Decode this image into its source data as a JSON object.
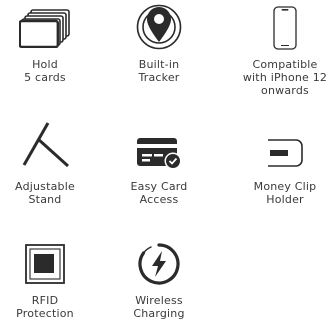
{
  "features": [
    {
      "id": "hold-cards",
      "label_line1": "Hold",
      "label_line2": "5 cards",
      "label_line3": "",
      "icon": "card-stack-icon"
    },
    {
      "id": "tracker",
      "label_line1": "Built-in",
      "label_line2": "Tracker",
      "label_line3": "",
      "icon": "location-pin-icon"
    },
    {
      "id": "compatible",
      "label_line1": "Compatible",
      "label_line2": "with iPhone 12",
      "label_line3": "onwards",
      "icon": "phone-icon"
    },
    {
      "id": "stand",
      "label_line1": "Adjustable",
      "label_line2": "Stand",
      "label_line3": "",
      "icon": "stand-icon"
    },
    {
      "id": "card-access",
      "label_line1": "Easy Card",
      "label_line2": "Access",
      "label_line3": "",
      "icon": "card-check-icon"
    },
    {
      "id": "money-clip",
      "label_line1": "Money Clip",
      "label_line2": "Holder",
      "label_line3": "",
      "icon": "money-clip-icon"
    },
    {
      "id": "rfid",
      "label_line1": "RFID",
      "label_line2": "Protection",
      "label_line3": "",
      "icon": "rfid-chip-icon"
    },
    {
      "id": "charging",
      "label_line1": "Wireless",
      "label_line2": "Charging",
      "label_line3": "",
      "icon": "lightning-bolt-icon"
    }
  ],
  "colors": {
    "icon": "#2b2b2b",
    "text": "#3a3a3a",
    "background": "#ffffff"
  }
}
